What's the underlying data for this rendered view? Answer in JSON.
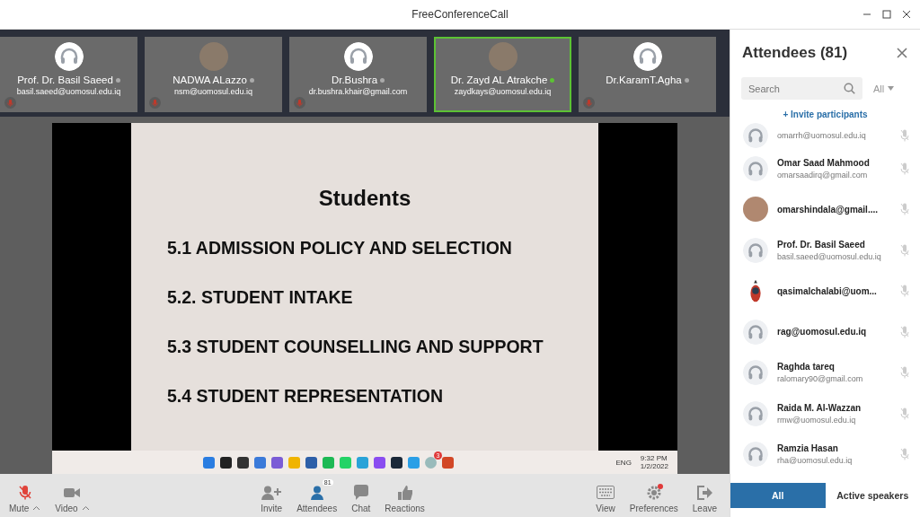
{
  "window": {
    "title": "FreeConferenceCall"
  },
  "tiles": [
    {
      "name": "Prof. Dr. Basil Saeed",
      "email": "basil.saeed@uomosul.edu.iq",
      "kind": "headset",
      "speaking": false,
      "muted": true
    },
    {
      "name": "NADWA ALazzo",
      "email": "nsm@uomosul.edu.iq",
      "kind": "photo",
      "speaking": false,
      "muted": true
    },
    {
      "name": "Dr.Bushra",
      "email": "dr.bushra.khair@gmail.com",
      "kind": "headset",
      "speaking": false,
      "muted": true
    },
    {
      "name": "Dr. Zayd AL Atrakche",
      "email": "zaydkays@uomosul.edu.iq",
      "kind": "photo",
      "speaking": true,
      "muted": false
    },
    {
      "name": "Dr.KaramT.Agha",
      "kind": "headset",
      "speaking": false,
      "muted": true
    }
  ],
  "slide": {
    "title": "Students",
    "items": [
      "5.1 ADMISSION POLICY AND SELECTION",
      "5.2. STUDENT INTAKE",
      "5.3 STUDENT COUNSELLING AND SUPPORT",
      "5.4 STUDENT REPRESENTATION"
    ]
  },
  "shared_taskbar": {
    "badge": "3",
    "language": "ENG",
    "time": "9:32 PM",
    "date": "1/2/2022"
  },
  "toolbar": [
    {
      "kind": "mic",
      "label": "Mute",
      "caret": true
    },
    {
      "kind": "video",
      "label": "Video",
      "caret": true
    },
    {
      "kind": "invite",
      "label": "Invite"
    },
    {
      "kind": "attendees",
      "label": "Attendees",
      "badge": "81"
    },
    {
      "kind": "chat",
      "label": "Chat"
    },
    {
      "kind": "reactions",
      "label": "Reactions"
    },
    {
      "kind": "view",
      "label": "View"
    },
    {
      "kind": "preferences",
      "label": "Preferences",
      "alert": true
    },
    {
      "kind": "leave",
      "label": "Leave"
    }
  ],
  "panel": {
    "title": "Attendees (81)",
    "search": {
      "placeholder": "Search"
    },
    "filter": "All",
    "invite": "+ Invite participants",
    "attendees": [
      {
        "email": "omarrh@uomosul.edu.iq",
        "kind": "headset"
      },
      {
        "name": "Omar Saad Mahmood",
        "email": "omarsaadirq@gmail.com",
        "kind": "headset"
      },
      {
        "name": "omarshindala@gmail....",
        "kind": "photo"
      },
      {
        "name": "Prof. Dr. Basil Saeed",
        "email": "basil.saeed@uomosul.edu.iq",
        "kind": "headset"
      },
      {
        "name": "qasimalchalabi@uom...",
        "kind": "figure"
      },
      {
        "name": "rag@uomosul.edu.iq",
        "kind": "headset"
      },
      {
        "name": "Raghda tareq",
        "email": "ralomary90@gmail.com",
        "kind": "headset"
      },
      {
        "name": "Raida M. Al-Wazzan",
        "email": "rmw@uomosul.edu.iq",
        "kind": "headset"
      },
      {
        "name": "Ramzia Hasan",
        "email": "rha@uomosul.edu.iq",
        "kind": "headset"
      }
    ],
    "tabs": [
      {
        "label": "All",
        "selected": true
      },
      {
        "label": "Active speakers",
        "selected": false
      }
    ]
  }
}
